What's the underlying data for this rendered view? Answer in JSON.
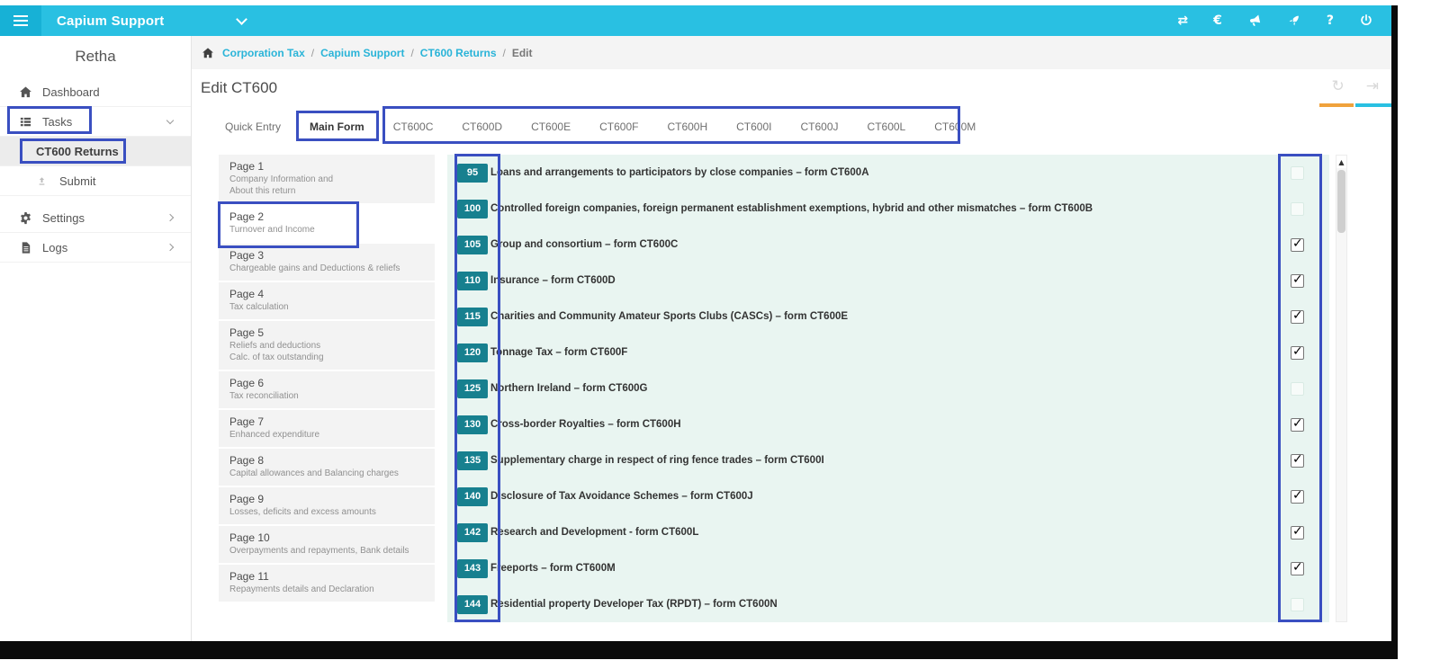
{
  "colors": {
    "topbar_cyan": "#29c0e2",
    "link_cyan": "#2ab4d8",
    "badge_teal": "#17808f",
    "form_background": "#e9f5f1",
    "annotation_blue": "#3a4fc1",
    "header_bar_orange": "#f0a23c"
  },
  "topbar": {
    "title": "Capium Support",
    "right_icons": [
      {
        "name": "transfer-icon",
        "glyph": "⇄"
      },
      {
        "name": "euro-icon",
        "glyph": "€"
      },
      {
        "name": "megaphone-icon",
        "glyph": ""
      },
      {
        "name": "rocket-icon",
        "glyph": ""
      },
      {
        "name": "help-icon",
        "glyph": "?"
      },
      {
        "name": "power-icon",
        "glyph": ""
      }
    ]
  },
  "sidebar": {
    "user_name": "Retha",
    "items": [
      {
        "label": "Dashboard"
      },
      {
        "label": "Tasks"
      },
      {
        "label": "CT600 Returns"
      },
      {
        "label": "Submit"
      },
      {
        "label": "Settings"
      },
      {
        "label": "Logs"
      }
    ]
  },
  "breadcrumb": {
    "links": [
      "Corporation Tax",
      "Capium Support",
      "CT600 Returns"
    ],
    "separator": "/",
    "current": "Edit"
  },
  "header": {
    "title": "Edit CT600",
    "refresh_glyph": "↻",
    "expand_glyph": "⇥"
  },
  "tabs": {
    "items": [
      {
        "label": "Quick Entry"
      },
      {
        "label": "Main Form",
        "active": true
      },
      {
        "label": "CT600C"
      },
      {
        "label": "CT600D"
      },
      {
        "label": "CT600E"
      },
      {
        "label": "CT600F"
      },
      {
        "label": "CT600H"
      },
      {
        "label": "CT600I"
      },
      {
        "label": "CT600J"
      },
      {
        "label": "CT600L"
      },
      {
        "label": "CT600M"
      }
    ]
  },
  "pages": {
    "items": [
      {
        "title": "Page 1",
        "subtitle": "Company Information and\nAbout this return"
      },
      {
        "title": "Page 2",
        "subtitle": "Turnover and Income",
        "active": true
      },
      {
        "title": "Page 3",
        "subtitle": "Chargeable gains and Deductions & reliefs"
      },
      {
        "title": "Page 4",
        "subtitle": "Tax calculation"
      },
      {
        "title": "Page 5",
        "subtitle": "Reliefs and deductions\nCalc. of tax outstanding"
      },
      {
        "title": "Page 6",
        "subtitle": "Tax reconciliation"
      },
      {
        "title": "Page 7",
        "subtitle": "Enhanced expenditure"
      },
      {
        "title": "Page 8",
        "subtitle": "Capital allowances and Balancing charges"
      },
      {
        "title": "Page 9",
        "subtitle": "Losses, deficits and excess amounts"
      },
      {
        "title": "Page 10",
        "subtitle": "Overpayments and repayments, Bank details"
      },
      {
        "title": "Page 11",
        "subtitle": "Repayments details and Declaration"
      }
    ]
  },
  "form": {
    "rows": [
      {
        "number": "95",
        "label": "Loans and arrangements to participators by close companies – form CT600A",
        "checked": false,
        "disabled": true
      },
      {
        "number": "100",
        "label": "Controlled foreign companies, foreign permanent establishment exemptions, hybrid and other mismatches – form CT600B",
        "checked": false,
        "disabled": true
      },
      {
        "number": "105",
        "label": "Group and consortium – form CT600C",
        "checked": true,
        "disabled": false
      },
      {
        "number": "110",
        "label": "Insurance – form CT600D",
        "checked": true,
        "disabled": false
      },
      {
        "number": "115",
        "label": "Charities and Community Amateur Sports Clubs (CASCs) – form CT600E",
        "checked": true,
        "disabled": false
      },
      {
        "number": "120",
        "label": "Tonnage Tax – form CT600F",
        "checked": true,
        "disabled": false
      },
      {
        "number": "125",
        "label": "Northern Ireland – form CT600G",
        "checked": false,
        "disabled": true
      },
      {
        "number": "130",
        "label": "Cross-border Royalties – form CT600H",
        "checked": true,
        "disabled": false
      },
      {
        "number": "135",
        "label": "Supplementary charge in respect of ring fence trades – form CT600I",
        "checked": true,
        "disabled": false
      },
      {
        "number": "140",
        "label": "Disclosure of Tax Avoidance Schemes – form CT600J",
        "checked": true,
        "disabled": false
      },
      {
        "number": "142",
        "label": "Research and Development - form CT600L",
        "checked": true,
        "disabled": false
      },
      {
        "number": "143",
        "label": "Freeports – form CT600M",
        "checked": true,
        "disabled": false
      },
      {
        "number": "144",
        "label": "Residential property Developer Tax (RPDT) – form CT600N",
        "checked": false,
        "disabled": true
      }
    ]
  },
  "scrollbar": {
    "up_glyph": "▲"
  }
}
